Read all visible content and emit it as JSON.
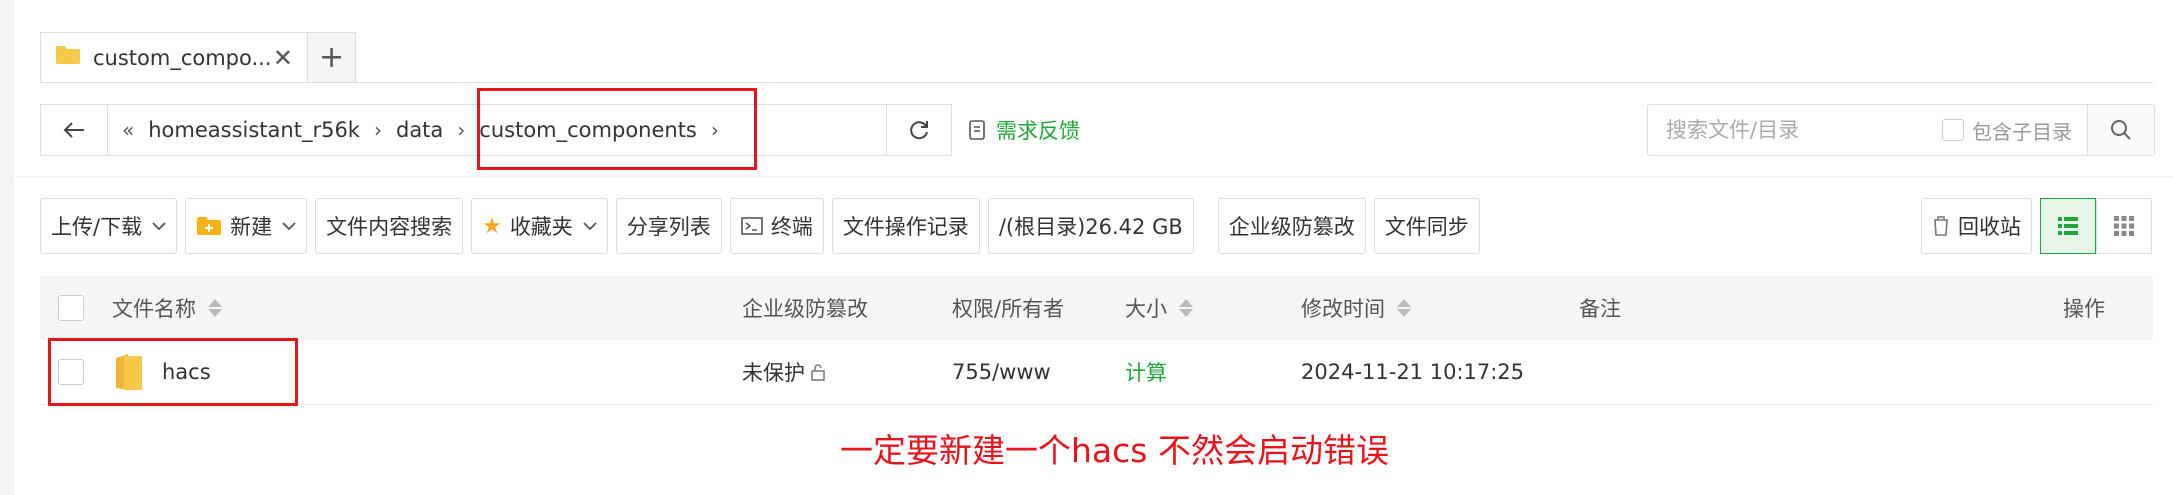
{
  "tabs": [
    {
      "label": "custom_compo..."
    }
  ],
  "breadcrumb": {
    "items": [
      "homeassistant_r56k",
      "data",
      "custom_components"
    ]
  },
  "feedback_label": "需求反馈",
  "search": {
    "placeholder": "搜索文件/目录",
    "include_sub_label": "包含子目录"
  },
  "toolbar": {
    "upload_download": "上传/下载",
    "new": "新建",
    "content_search": "文件内容搜索",
    "favorites": "收藏夹",
    "share_list": "分享列表",
    "terminal": "终端",
    "operation_log": "文件操作记录",
    "disk_usage": "/(根目录)26.42 GB",
    "tamper_proof": "企业级防篡改",
    "file_sync": "文件同步",
    "recycle_bin": "回收站"
  },
  "table": {
    "headers": {
      "name": "文件名称",
      "tamper": "企业级防篡改",
      "perm_owner": "权限/所有者",
      "size": "大小",
      "modified": "修改时间",
      "remark": "备注",
      "action": "操作"
    },
    "rows": [
      {
        "name": "hacs",
        "tamper": "未保护",
        "perm_owner": "755/www",
        "size": "计算",
        "modified": "2024-11-21 10:17:25",
        "remark": ""
      }
    ]
  },
  "annotation_text": "一定要新建一个hacs  不然会启动错误",
  "colors": {
    "accent": "#20a53a",
    "annotation": "#e8141c",
    "folder": "#f7c948"
  },
  "icons": [
    "folder-icon",
    "close-icon",
    "plus-icon",
    "back-arrow-icon",
    "refresh-icon",
    "feedback-icon",
    "search-icon",
    "chevron-down-icon",
    "new-folder-icon",
    "star-icon",
    "terminal-icon",
    "trash-icon",
    "list-view-icon",
    "grid-view-icon",
    "lock-icon"
  ]
}
